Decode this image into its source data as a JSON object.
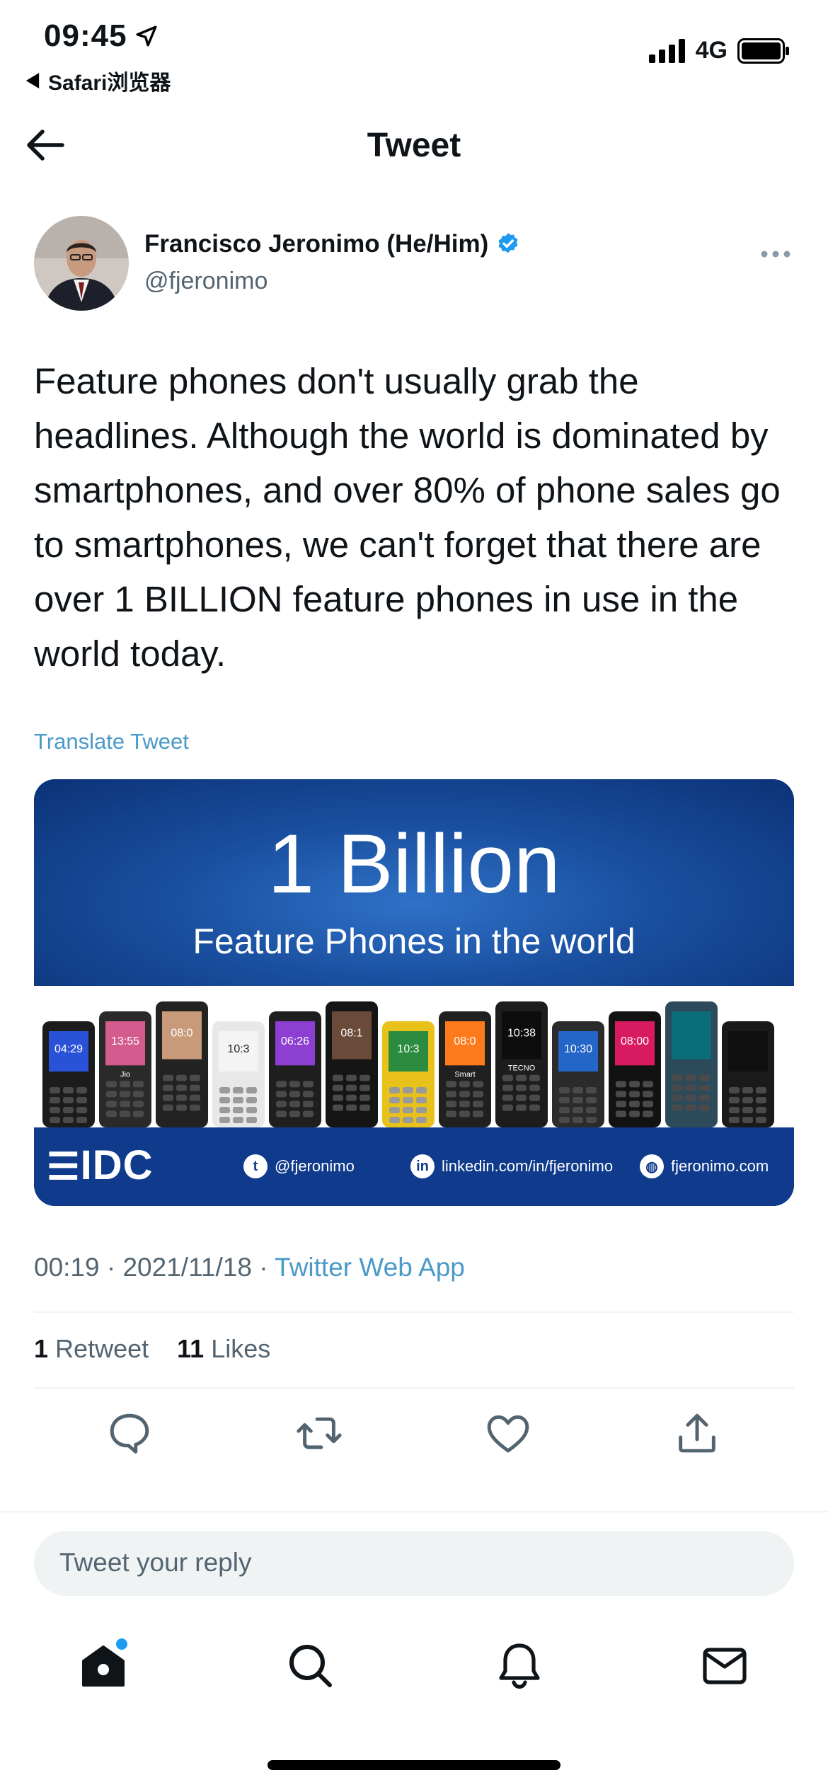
{
  "status_bar": {
    "time": "09:45",
    "back_app": "Safari浏览器",
    "network": "4G"
  },
  "header": {
    "title": "Tweet"
  },
  "author": {
    "name": "Francisco Jeronimo (He/Him)",
    "handle": "@fjeronimo",
    "verified": true
  },
  "tweet": {
    "text": "Feature phones don't usually grab the headlines. Although the world is dominated by smartphones, and over 80% of phone sales go to smartphones, we can't forget that there are over 1 BILLION feature phones in use in the world today.",
    "translate_label": "Translate Tweet"
  },
  "media": {
    "headline": "1 Billion",
    "subheadline": "Feature Phones in the world",
    "logo": "IDC",
    "footer_twitter": "@fjeronimo",
    "footer_linkedin": "linkedin.com/in/fjeronimo",
    "footer_web": "fjeronimo.com",
    "phone_screens": [
      "04:29",
      "13:55",
      "08:0",
      "10:3",
      "06:26",
      "08:1",
      "10:3",
      "08:0",
      "10:38",
      "10:30",
      "08:00"
    ],
    "phone_brands": [
      "Jio",
      "Smart",
      "TECNO"
    ]
  },
  "meta": {
    "time": "00:19",
    "date": "2021/11/18",
    "separator": "·",
    "app": "Twitter Web App"
  },
  "stats": {
    "retweets_count": "1",
    "retweets_label": "Retweet",
    "likes_count": "11",
    "likes_label": "Likes"
  },
  "reply": {
    "placeholder": "Tweet your reply"
  },
  "colors": {
    "accent": "#1d9bf0",
    "link": "#4a99c9",
    "secondary_text": "#536471",
    "media_blue": "#103b8c"
  },
  "icons": {
    "back": "arrow-left-icon",
    "verified": "verified-badge-icon",
    "more": "more-dots-icon",
    "reply": "reply-icon",
    "retweet": "retweet-icon",
    "like": "heart-icon",
    "share": "share-icon",
    "home": "home-icon",
    "search": "search-icon",
    "notifications": "bell-icon",
    "messages": "mail-icon"
  }
}
